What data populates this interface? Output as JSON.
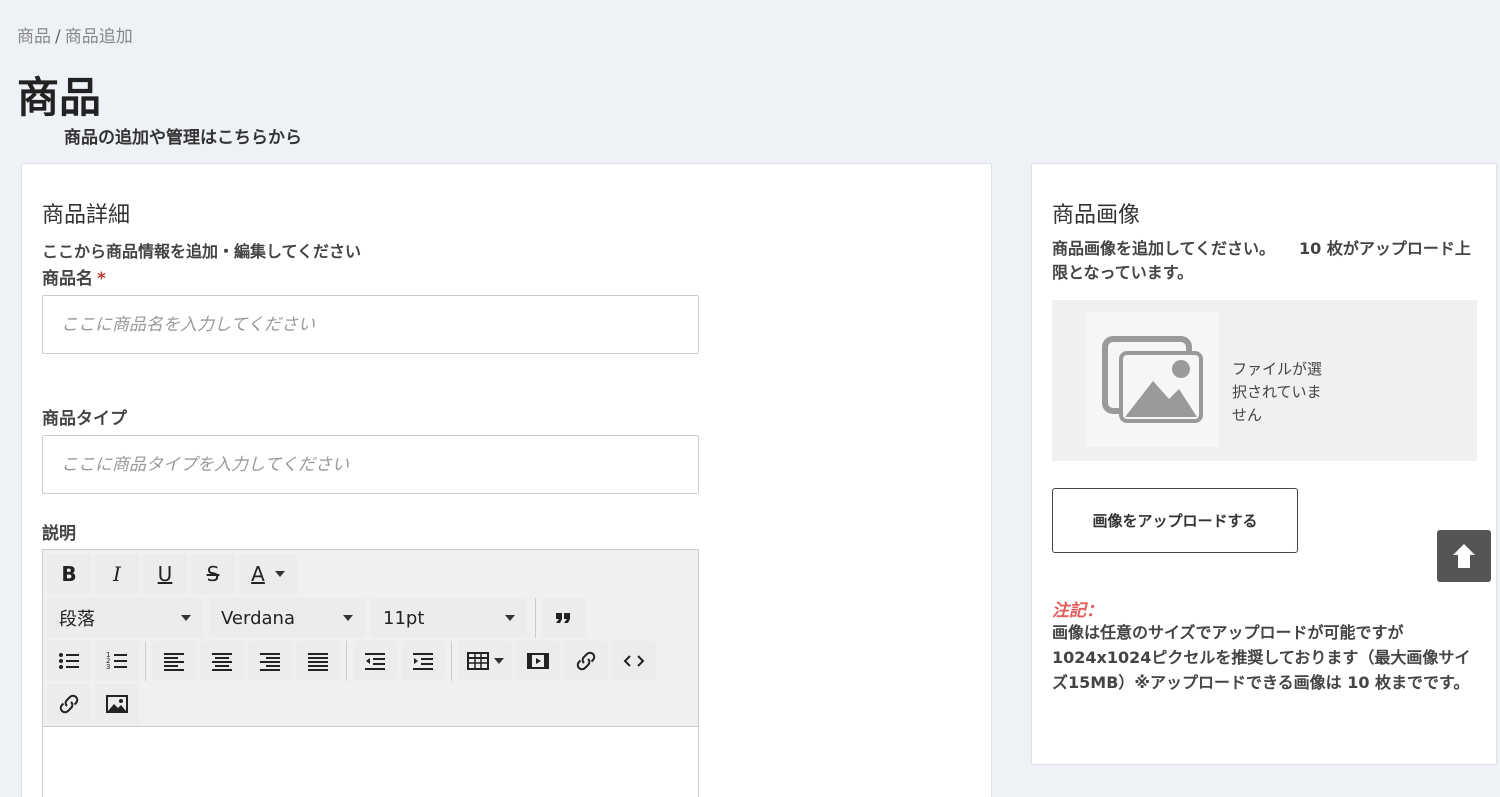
{
  "breadcrumb": {
    "parent": "商品",
    "separator": "/",
    "current": "商品追加"
  },
  "header": {
    "title": "商品",
    "subtitle": "商品の追加や管理はこちらから"
  },
  "details": {
    "title": "商品詳細",
    "description": "ここから商品情報を追加・編集してください",
    "name_label": "商品名",
    "required_mark": "*",
    "name_placeholder": "ここに商品名を入力してください",
    "type_label": "商品タイプ",
    "type_placeholder": "ここに商品タイプを入力してください",
    "desc_label": "説明"
  },
  "editor": {
    "format_select": "段落",
    "font_select": "Verdana",
    "size_select": "11pt"
  },
  "images": {
    "title": "商品画像",
    "description": "商品画像を追加してください。　　10 枚がアップロード上限となっています。",
    "no_file": "ファイルが選択されていません",
    "upload_button": "画像をアップロードする",
    "note_title": "注記：",
    "note_text": "画像は任意のサイズでアップロードが可能ですが1024x1024ピクセルを推奨しております（最大画像サイズ15MB）※アップロードできる画像は 10 枚までです。"
  },
  "colors": {
    "required": "#c0392b",
    "note": "#e25b5b",
    "scroll_button": "#555555"
  }
}
